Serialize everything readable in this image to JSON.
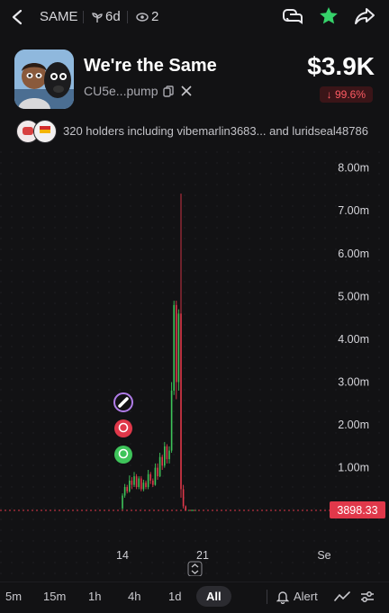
{
  "topbar": {
    "ticker": "SAME",
    "age": "6d",
    "watchers": "2"
  },
  "token": {
    "name": "We're the Same",
    "address": "CU5e...pump",
    "price": "$3.9K",
    "change": "↓ 99.6%"
  },
  "holders": {
    "text": "320 holders including vibemarlin3683... and luridseal48786"
  },
  "chart_data": {
    "type": "candlestick",
    "y_ticks": [
      "8.00m",
      "7.00m",
      "6.00m",
      "5.00m",
      "4.00m",
      "3.00m",
      "2.00m",
      "1.00m"
    ],
    "x_ticks": [
      "14",
      "21",
      "Se"
    ],
    "current_value_label": "3898.33",
    "ylim": [
      0,
      8500000
    ],
    "grid": true,
    "candles": [
      {
        "o": 0.05,
        "c": 0.35,
        "h": 0.4,
        "l": 0.02
      },
      {
        "o": 0.35,
        "c": 0.55,
        "h": 0.62,
        "l": 0.3
      },
      {
        "o": 0.55,
        "c": 0.45,
        "h": 0.6,
        "l": 0.4
      },
      {
        "o": 0.45,
        "c": 0.7,
        "h": 0.82,
        "l": 0.42
      },
      {
        "o": 0.7,
        "c": 0.6,
        "h": 0.78,
        "l": 0.5
      },
      {
        "o": 0.6,
        "c": 0.8,
        "h": 0.9,
        "l": 0.55
      },
      {
        "o": 0.8,
        "c": 0.55,
        "h": 0.85,
        "l": 0.5
      },
      {
        "o": 0.55,
        "c": 0.75,
        "h": 0.8,
        "l": 0.5
      },
      {
        "o": 0.75,
        "c": 0.5,
        "h": 0.8,
        "l": 0.45
      },
      {
        "o": 0.5,
        "c": 0.65,
        "h": 0.72,
        "l": 0.45
      },
      {
        "o": 0.65,
        "c": 0.55,
        "h": 0.7,
        "l": 0.5
      },
      {
        "o": 0.55,
        "c": 0.85,
        "h": 0.95,
        "l": 0.5
      },
      {
        "o": 0.85,
        "c": 0.7,
        "h": 0.9,
        "l": 0.62
      },
      {
        "o": 0.7,
        "c": 0.6,
        "h": 0.75,
        "l": 0.55
      },
      {
        "o": 0.6,
        "c": 1.0,
        "h": 1.1,
        "l": 0.58
      },
      {
        "o": 1.0,
        "c": 0.8,
        "h": 1.1,
        "l": 0.72
      },
      {
        "o": 0.8,
        "c": 1.25,
        "h": 1.35,
        "l": 0.78
      },
      {
        "o": 1.25,
        "c": 1.05,
        "h": 1.3,
        "l": 0.95
      },
      {
        "o": 1.05,
        "c": 1.5,
        "h": 1.6,
        "l": 1.0
      },
      {
        "o": 1.5,
        "c": 1.2,
        "h": 1.55,
        "l": 1.1
      },
      {
        "o": 1.2,
        "c": 1.4,
        "h": 1.5,
        "l": 1.1
      },
      {
        "o": 1.4,
        "c": 2.8,
        "h": 3.0,
        "l": 1.35
      },
      {
        "o": 2.8,
        "c": 4.8,
        "h": 4.9,
        "l": 2.7
      },
      {
        "o": 4.8,
        "c": 3.0,
        "h": 4.9,
        "l": 2.6
      },
      {
        "o": 3.0,
        "c": 4.6,
        "h": 4.7,
        "l": 2.8
      },
      {
        "o": 4.6,
        "c": 0.5,
        "h": 7.4,
        "l": 0.3
      },
      {
        "o": 0.5,
        "c": 0.1,
        "h": 0.6,
        "l": 0.05
      },
      {
        "o": 0.1,
        "c": 0.004,
        "h": 0.12,
        "l": 0.0
      }
    ]
  },
  "timeframes": [
    "5m",
    "15m",
    "1h",
    "4h",
    "1d",
    "All"
  ],
  "active_timeframe": "All",
  "alert_label": "Alert",
  "colors": {
    "up": "#3ec45a",
    "down": "#e0384a",
    "accent_green": "#36d26a",
    "price_line": "#e0384a"
  }
}
